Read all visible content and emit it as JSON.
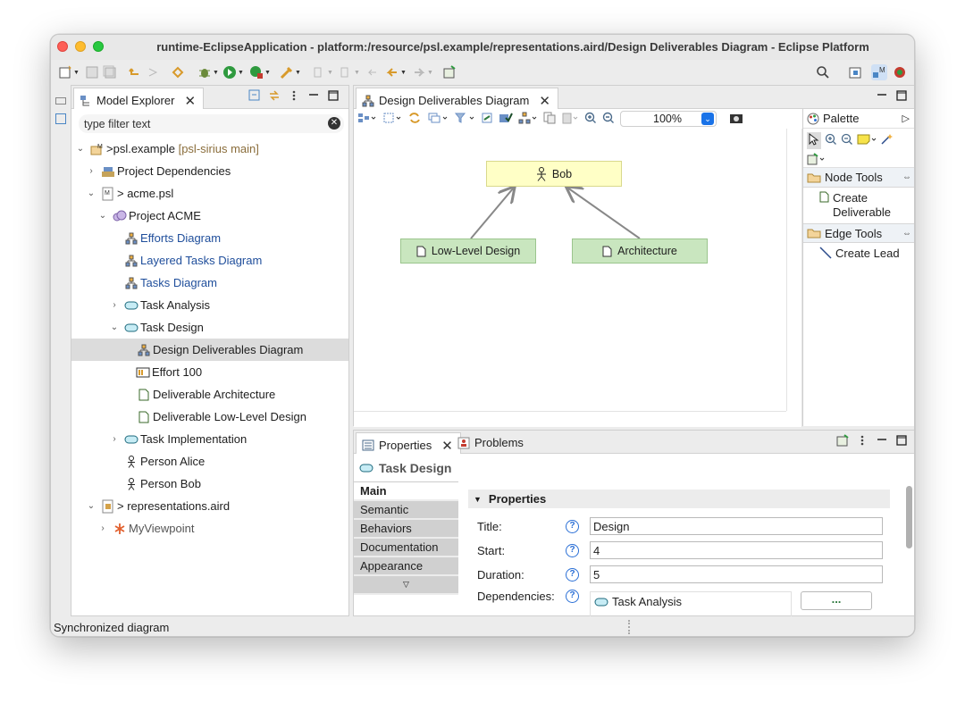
{
  "window": {
    "title": "runtime-EclipseApplication - platform:/resource/psl.example/representations.aird/Design Deliverables Diagram - Eclipse Platform"
  },
  "model_explorer": {
    "tab_label": "Model Explorer",
    "filter_placeholder": "type filter text",
    "tree": {
      "root_prefix": "> ",
      "root_name": "psl.example",
      "root_branch": "[psl-sirius main]",
      "project_dependencies": "Project Dependencies",
      "acme_psl": "> acme.psl",
      "project_acme": "Project ACME",
      "efforts_diagram": "Efforts Diagram",
      "layered_tasks_diagram": "Layered Tasks Diagram",
      "tasks_diagram": "Tasks Diagram",
      "task_analysis": "Task Analysis",
      "task_design": "Task Design",
      "design_deliverables_diagram": "Design Deliverables Diagram",
      "effort_100": "Effort 100",
      "deliverable_architecture": "Deliverable Architecture",
      "deliverable_low_level_design": "Deliverable Low-Level Design",
      "task_implementation": "Task Implementation",
      "person_alice": "Person Alice",
      "person_bob": "Person Bob",
      "representations_aird": "> representations.aird",
      "my_viewpoint": "MyViewpoint"
    }
  },
  "editor": {
    "tab_label": "Design Deliverables Diagram",
    "zoom": "100%",
    "nodes": {
      "bob": "Bob",
      "low_level_design": "Low-Level Design",
      "architecture": "Architecture"
    }
  },
  "palette": {
    "title": "Palette",
    "node_tools": "Node Tools",
    "create_deliverable": "Create Deliverable",
    "edge_tools": "Edge Tools",
    "create_lead": "Create Lead"
  },
  "properties_view": {
    "tab_properties": "Properties",
    "tab_problems": "Problems",
    "header": "Task Design",
    "side_tabs": [
      "Main",
      "Semantic",
      "Behaviors",
      "Documentation",
      "Appearance"
    ],
    "section_title": "Properties",
    "fields": {
      "title_label": "Title:",
      "title_value": "Design",
      "start_label": "Start:",
      "start_value": "4",
      "duration_label": "Duration:",
      "duration_value": "5",
      "dependencies_label": "Dependencies:",
      "dependencies_value": "Task Analysis",
      "dependencies_button": "..."
    }
  },
  "statusbar": {
    "text": "Synchronized diagram"
  },
  "colors": {
    "selection": "#dcdcdc",
    "link_blue": "#1f4e9b",
    "person_node": "#ffffc6",
    "deliverable_node": "#c9e6bf",
    "help_blue": "#2a6fd6"
  }
}
